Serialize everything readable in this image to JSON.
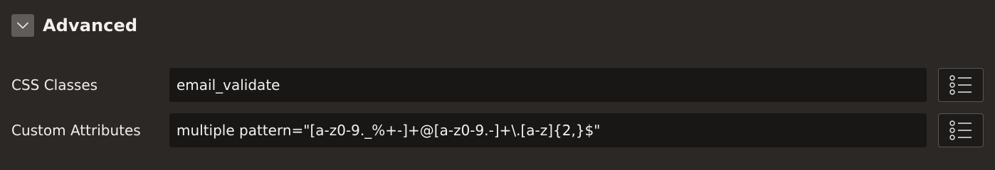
{
  "section": {
    "title": "Advanced",
    "toggle_icon": "chevron-down-icon"
  },
  "fields": [
    {
      "label": "CSS Classes",
      "value": "email_validate",
      "picker_icon": "list-icon"
    },
    {
      "label": "Custom Attributes",
      "value": "multiple pattern=\"[a-z0-9._%+-]+@[a-z0-9.-]+\\.[a-z]{2,}$\"",
      "picker_icon": "list-icon"
    }
  ],
  "colors": {
    "background": "#2b2825",
    "input_background": "#181716",
    "toggle_background": "#5f5c59",
    "text": "#f2f0ee"
  }
}
